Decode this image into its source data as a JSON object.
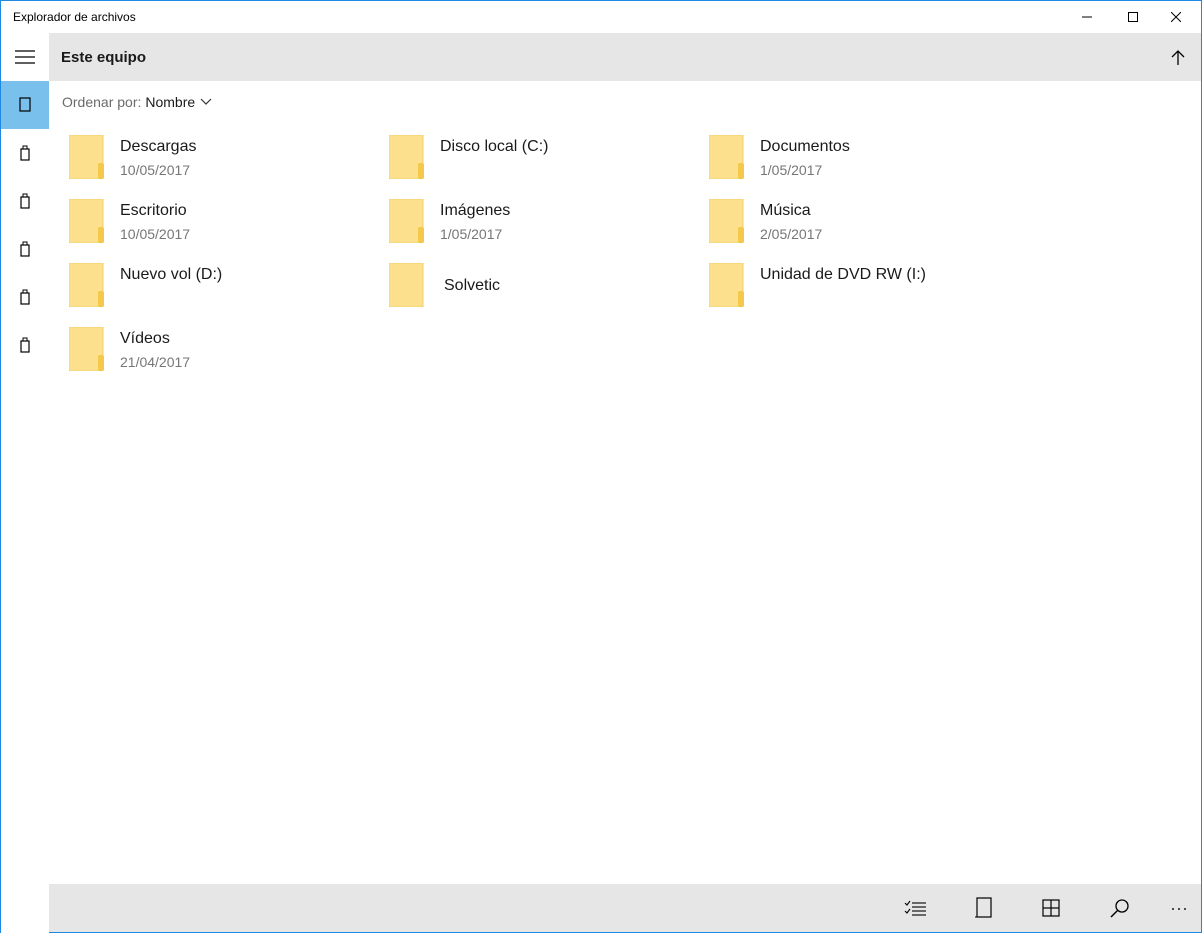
{
  "window": {
    "title": "Explorador de archivos"
  },
  "header": {
    "title": "Este equipo"
  },
  "sort": {
    "label": "Ordenar por:",
    "value": "Nombre"
  },
  "rail": {
    "items": [
      {
        "icon": "tablet-icon",
        "active": true
      },
      {
        "icon": "usb-drive-icon",
        "active": false
      },
      {
        "icon": "usb-drive-icon",
        "active": false
      },
      {
        "icon": "usb-drive-icon",
        "active": false
      },
      {
        "icon": "usb-drive-icon",
        "active": false
      },
      {
        "icon": "usb-drive-icon",
        "active": false
      }
    ]
  },
  "items": [
    {
      "name": "Descargas",
      "date": "10/05/2017"
    },
    {
      "name": "Disco local (C:)",
      "date": ""
    },
    {
      "name": "Documentos",
      "date": "1/05/2017"
    },
    {
      "name": "Escritorio",
      "date": "10/05/2017"
    },
    {
      "name": "Imágenes",
      "date": "1/05/2017"
    },
    {
      "name": "Música",
      "date": "2/05/2017"
    },
    {
      "name": "Nuevo vol (D:)",
      "date": ""
    },
    {
      "name": "Solvetic",
      "date": ""
    },
    {
      "name": "Unidad de DVD RW (I:)",
      "date": ""
    },
    {
      "name": "Vídeos",
      "date": "21/04/2017"
    }
  ],
  "bottombar": {
    "buttons": [
      "select-list-icon",
      "tablet-icon",
      "grid-view-icon",
      "search-icon"
    ],
    "more": "···"
  },
  "colors": {
    "accent": "#79c0ec",
    "bar": "#e6e6e6",
    "folder": "#fde08d",
    "border": "#1e88e5"
  }
}
